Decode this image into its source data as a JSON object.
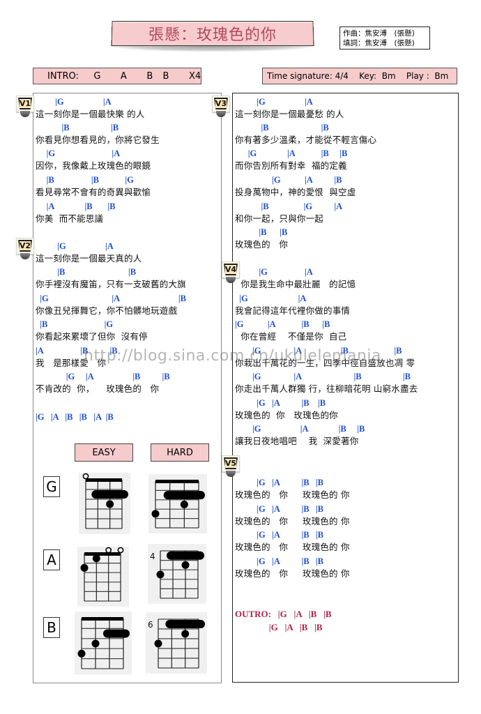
{
  "header": {
    "title": "張懸：玫瑰色的你",
    "credits": [
      "作曲：焦安溥　(張懸)",
      "填詞：焦安溥　(張懸)"
    ]
  },
  "intro": "INTRO:   G    A    B  B    X4",
  "meta": "Time signature: 4/4    Key:  Bm    Play :  Bm",
  "colors": {
    "chord": "#1f4fd0",
    "outro": "#b02147",
    "label_bg": "#f6cbcb",
    "title_text": "#b1485a"
  },
  "sections": {
    "v1": {
      "label": "V1",
      "lines": [
        {
          "chords": "         |G                  |A",
          "lyric": "這一刻你是一個最快樂 的人"
        },
        {
          "chords": "            |B                   |B",
          "lyric": "你看見你想看見的，你將它發生"
        },
        {
          "chords": "     |G                          |A",
          "lyric": "因你，我像戴上玫瑰色的眼鏡"
        },
        {
          "chords": "     |B                 |B            |G",
          "lyric": "看見尋常不會有的奇異與歡愉"
        },
        {
          "chords": "     |A              |B       |B",
          "lyric": "你美  而不能思議"
        }
      ]
    },
    "v2": {
      "label": "V2",
      "lines": [
        {
          "chords": "          |G                  |A",
          "lyric": "這一刻你是一個最天真的人"
        },
        {
          "chords": "          |B                             |B",
          "lyric": "你手裡沒有魔笛，只有一支破舊的大旗"
        },
        {
          "chords": "  |G                             |A                           |B",
          "lyric": "你像丑兒揮舞它，你不怕髒地玩遊戲"
        },
        {
          "chords": "  |B                          |G",
          "lyric": "你看起來累壞了但你  沒有停"
        },
        {
          "chords": "|A                 |B          |B",
          "lyric": "我   是那樣愛   你"
        },
        {
          "chords": "              |G     |A                  |B          |B",
          "lyric": "不肯改的  你，    玫瑰色的   你"
        }
      ],
      "tail": "|G   |A   |B   |B   |A  |B"
    },
    "v3": {
      "label": "V3",
      "lines": [
        {
          "chords": "          |G                  |A",
          "lyric": "這一刻你是一個最憂愁 的人"
        },
        {
          "chords": "            |B                        |B",
          "lyric": "你有著多少溫柔，才能從不輕言傷心"
        },
        {
          "chords": "      |G              |A            |B     |B",
          "lyric": "而你告別所有對幸  福的定義"
        },
        {
          "chords": "                 |G           |A          |B",
          "lyric": "投身萬物中，神的愛恨  與空虛"
        },
        {
          "chords": "            |B                |G          |A",
          "lyric": "和你一起，只與你一起"
        },
        {
          "chords": "           |B      |B",
          "lyric": "玫瑰色的   你"
        }
      ]
    },
    "v4": {
      "label": "V4",
      "lines": [
        {
          "chords": "           |G                 |A",
          "lyric": "  你是我生命中最壯麗   的記憶"
        },
        {
          "chords": "  |G                       |A",
          "lyric": "我會記得這年代裡你做的事情"
        },
        {
          "chords": "|G           |A            |B      |B",
          "lyric": "  你在曾經    不僅是你  自己"
        },
        {
          "chords": "        |G               |A                  |B                     |B",
          "lyric": "你栽出千萬花的一生，四季中徑自盛放也凋 零"
        },
        {
          "chords": "        |G               |A                        |B                   |B",
          "lyric": "你走出千萬人群獨 行，往柳暗花明 山窮水盡去"
        },
        {
          "chords": "          |G   |A          |B    |B",
          "lyric": "玫瑰色的  你   玫瑰色的你"
        },
        {
          "chords": "        |G                  |A              |B     |B",
          "lyric": "讓我日夜地唱吧    我  深愛著你"
        }
      ]
    },
    "v5": {
      "label": "V5",
      "lines": [
        {
          "chords": "          |G   |A          |B   |B",
          "lyric": "玫瑰色的   你     玫瑰色的 你"
        },
        {
          "chords": "          |G   |A          |B   |B",
          "lyric": "玫瑰色的   你     玫瑰色的 你"
        },
        {
          "chords": "          |G   |A          |B   |B",
          "lyric": "玫瑰色的   你     玫瑰色的 你"
        },
        {
          "chords": "          |G   |A          |B   |B",
          "lyric": "玫瑰色的   你     玫瑰色的 你"
        }
      ]
    }
  },
  "outro": {
    "line1": "OUTRO:   |G   |A   |B   |B",
    "line2": "               |G   |A   |B   |B"
  },
  "chord_charts": {
    "easy_label": "EASY",
    "hard_label": "HARD",
    "chords": [
      {
        "name": "G",
        "easy": {
          "fret_label": "",
          "open": [
            0
          ],
          "nut": true,
          "barres": [
            {
              "fret": 2,
              "from": 1,
              "to": 3
            }
          ],
          "dots": [
            {
              "string": 2,
              "fret": 3
            }
          ]
        },
        "hard": {
          "fret_label": "",
          "open": [],
          "nut": true,
          "barres": [
            {
              "fret": 2,
              "from": 1,
              "to": 3
            }
          ],
          "dots": [
            {
              "string": 2,
              "fret": 3
            },
            {
              "string": 0,
              "fret": 4
            }
          ]
        }
      },
      {
        "name": "A",
        "easy": {
          "fret_label": "",
          "open": [
            2,
            3
          ],
          "nut": true,
          "barres": [],
          "dots": [
            {
              "string": 1,
              "fret": 1
            },
            {
              "string": 0,
              "fret": 2
            }
          ]
        },
        "hard": {
          "fret_label": "4",
          "open": [],
          "nut": false,
          "barres": [
            {
              "fret": 1,
              "from": 1,
              "to": 3
            }
          ],
          "dots": [
            {
              "string": 2,
              "fret": 2
            },
            {
              "string": 0,
              "fret": 3
            }
          ]
        }
      },
      {
        "name": "B",
        "easy": {
          "fret_label": "",
          "open": [],
          "nut": true,
          "barres": [
            {
              "fret": 2,
              "from": 2,
              "to": 3
            }
          ],
          "dots": [
            {
              "string": 1,
              "fret": 3
            },
            {
              "string": 0,
              "fret": 4
            }
          ]
        },
        "hard": {
          "fret_label": "6",
          "open": [],
          "nut": false,
          "barres": [
            {
              "fret": 1,
              "from": 1,
              "to": 3
            }
          ],
          "dots": [
            {
              "string": 2,
              "fret": 2
            },
            {
              "string": 0,
              "fret": 3
            }
          ]
        }
      }
    ]
  },
  "watermark": "http://blog.sina.com.cn/ukulelemania"
}
